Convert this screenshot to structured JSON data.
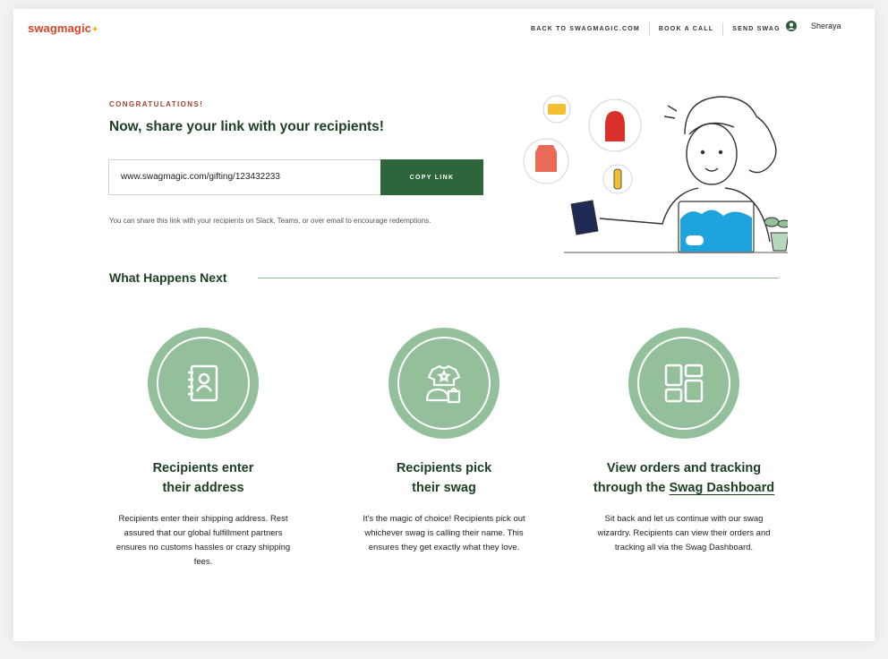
{
  "brand": {
    "logo": "swagmagic",
    "spark": "✦",
    "accent": "#d9452b",
    "green": "#2f653a",
    "light_green": "#93c09b"
  },
  "nav": {
    "back": "BACK TO SWAGMAGIC.COM",
    "book": "BOOK A CALL",
    "send": "SEND SWAG",
    "user": "Sheraya"
  },
  "hero": {
    "eyebrow": "CONGRATULATIONS!",
    "title": "Now, share your link with your recipients!",
    "link": "www.swagmagic.com/gifting/123432233",
    "copy": "COPY LINK",
    "hint": "You can share this link with your recipients on Slack, Teams, or over email to encourage redemptions."
  },
  "next": {
    "title": "What Happens Next",
    "steps": [
      {
        "icon": "address-book-icon",
        "title_1": "Recipients enter",
        "title_2": "their address",
        "body": "Recipients enter their shipping address. Rest assured that our global fulfillment partners ensures no customs hassles or crazy shipping fees."
      },
      {
        "icon": "swag-items-icon",
        "title_1": "Recipients pick",
        "title_2": "their swag",
        "body": "It's the magic of choice! Recipients pick out whichever swag is calling their name. This ensures they get exactly what they love."
      },
      {
        "icon": "dashboard-grid-icon",
        "title_1": "View orders and tracking",
        "title_2a": "through the ",
        "title_2b": "Swag Dashboard",
        "body": "Sit back and let us continue with our swag wizardry. Recipients can view their orders and tracking all via the Swag Dashboard."
      }
    ]
  }
}
